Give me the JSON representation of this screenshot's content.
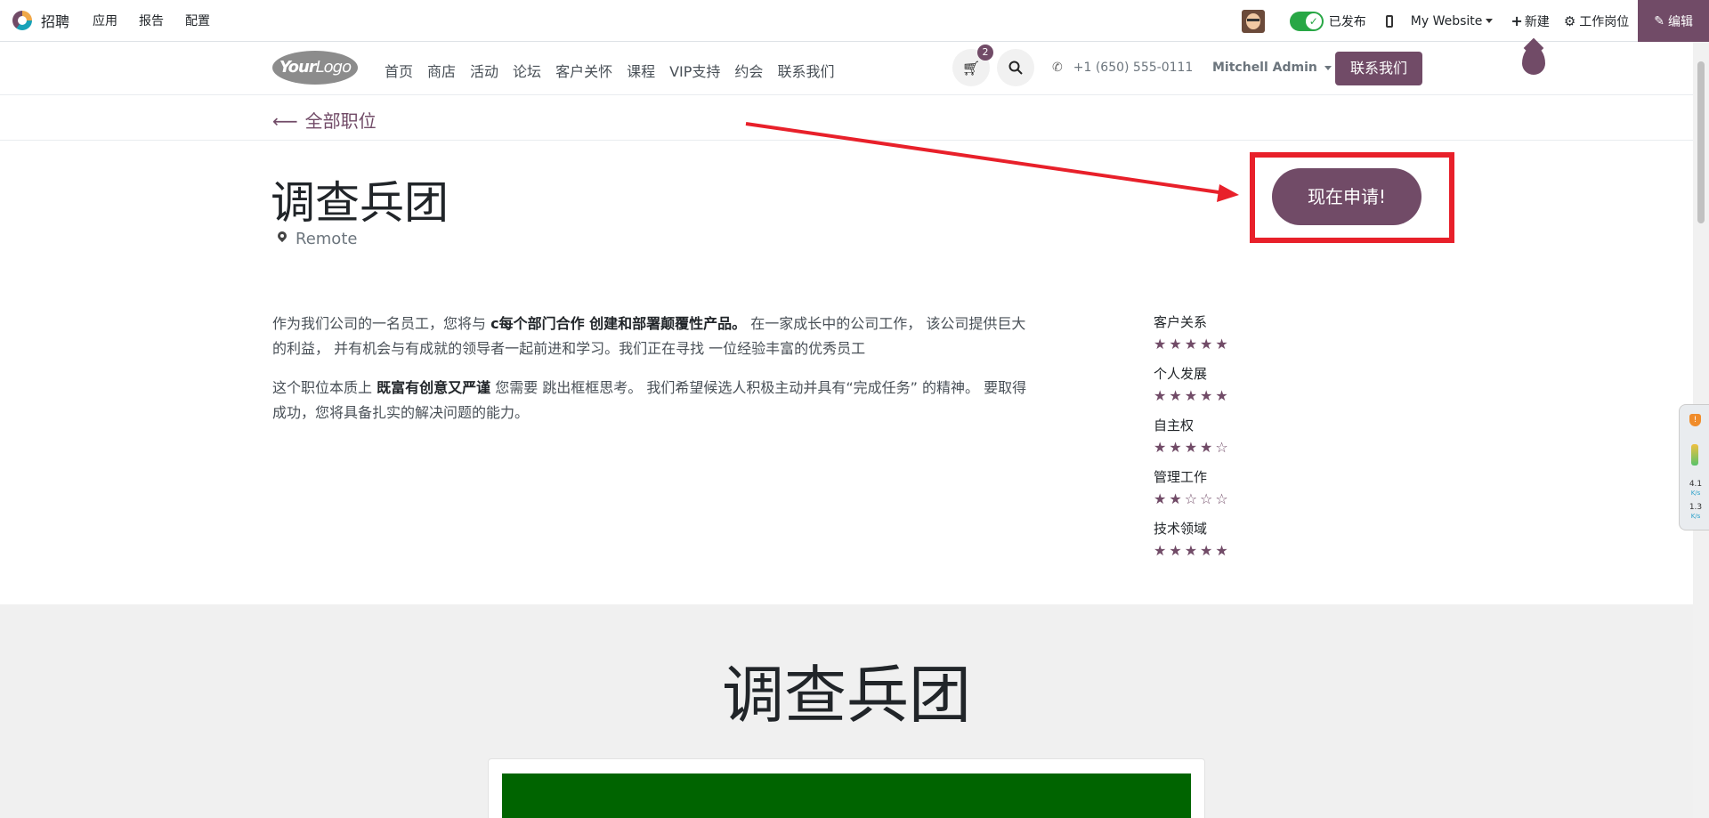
{
  "odoo_bar": {
    "app_name": "招聘",
    "menu": [
      "应用",
      "报告",
      "配置"
    ],
    "published_label": "已发布",
    "website_label": "My Website",
    "new_label": "新建",
    "jobs_label": "工作岗位",
    "edit_label": "编辑"
  },
  "site_header": {
    "logo_part1": "Your",
    "logo_part2": "Logo",
    "nav": [
      "首页",
      "商店",
      "活动",
      "论坛",
      "客户关怀",
      "课程",
      "VIP支持",
      "约会",
      "联系我们"
    ],
    "cart_count": "2",
    "phone": "+1 (650) 555-0111",
    "user": "Mitchell Admin",
    "contact_button": "联系我们"
  },
  "back_link": "全部职位",
  "job": {
    "title": "调查兵团",
    "location": "Remote",
    "apply_button": "现在申请!"
  },
  "description": {
    "p1_a": "作为我们公司的一名员工，您将与 ",
    "p1_b": "c每个部门合作 创建和部署颠覆性产品。",
    "p1_c": " 在一家成长中的公司工作， 该公司提供巨大的利益， 并有机会与有成就的领导者一起前进和学习。我们正在寻找 一位经验丰富的优秀员工",
    "p2_a": "这个职位本质上 ",
    "p2_b": "既富有创意又严谨",
    "p2_c": " 您需要 跳出框框思考。 我们希望候选人积极主动并具有“完成任务” 的精神。 要取得成功，您将具备扎实的解决问题的能力。"
  },
  "ratings": [
    {
      "label": "客户关系",
      "stars": 5
    },
    {
      "label": "个人发展",
      "stars": 5
    },
    {
      "label": "自主权",
      "stars": 4
    },
    {
      "label": "管理工作",
      "stars": 2
    },
    {
      "label": "技术领域",
      "stars": 5
    }
  ],
  "section": {
    "title": "调查兵团"
  },
  "side_widget": {
    "up_value": "4.1",
    "up_unit": "K/s",
    "down_value": "1.3",
    "down_unit": "K/s"
  },
  "colors": {
    "brand": "#714b67",
    "annotation_red": "#e8202a",
    "published_green": "#28a745",
    "banner_green": "#006400"
  }
}
